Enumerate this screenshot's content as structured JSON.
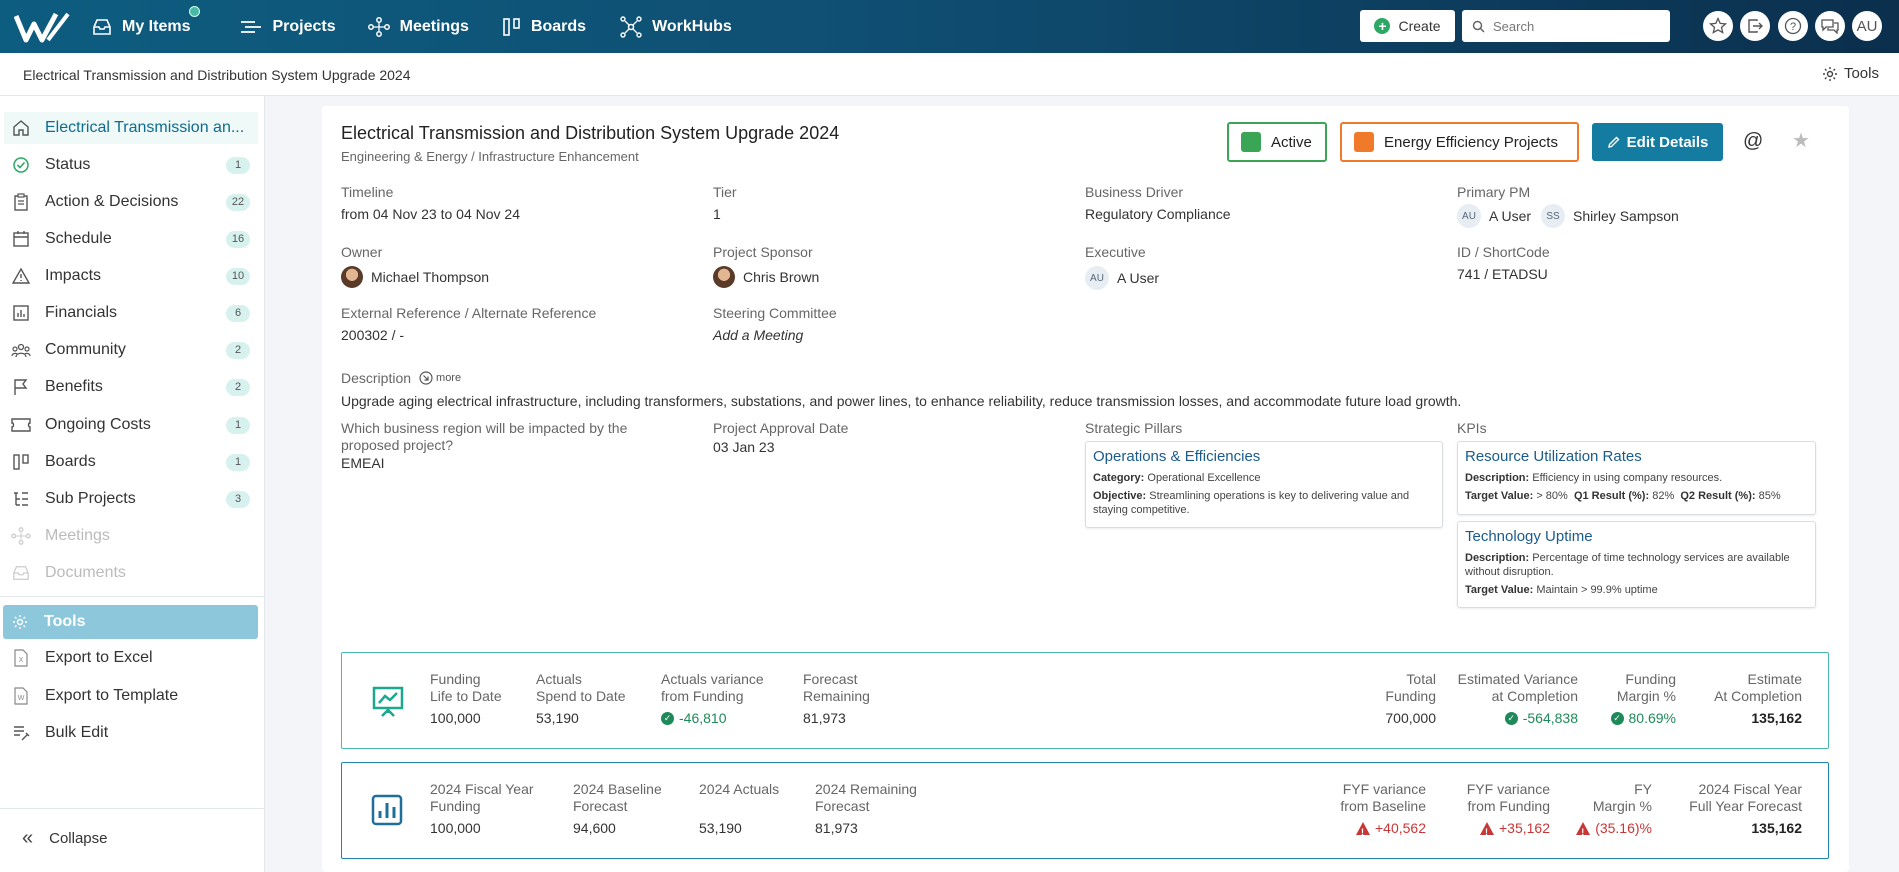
{
  "nav": {
    "items": [
      {
        "label": "My Items",
        "icon": "inbox-icon"
      },
      {
        "label": "Projects",
        "icon": "projects-icon"
      },
      {
        "label": "Meetings",
        "icon": "meetings-icon"
      },
      {
        "label": "Boards",
        "icon": "boards-icon"
      },
      {
        "label": "WorkHubs",
        "icon": "workhubs-icon"
      }
    ],
    "create_label": "Create",
    "search_placeholder": "Search",
    "avatar_initials": "AU"
  },
  "subheader": {
    "breadcrumb": "Electrical Transmission and Distribution System Upgrade 2024",
    "tools_label": "Tools"
  },
  "sidebar": {
    "items": [
      {
        "label": "Electrical Transmission an...",
        "count": ""
      },
      {
        "label": "Status",
        "count": "1"
      },
      {
        "label": "Action & Decisions",
        "count": "22"
      },
      {
        "label": "Schedule",
        "count": "16"
      },
      {
        "label": "Impacts",
        "count": "10"
      },
      {
        "label": "Financials",
        "count": "6"
      },
      {
        "label": "Community",
        "count": "2"
      },
      {
        "label": "Benefits",
        "count": "2"
      },
      {
        "label": "Ongoing Costs",
        "count": "1"
      },
      {
        "label": "Boards",
        "count": "1"
      },
      {
        "label": "Sub Projects",
        "count": "3"
      },
      {
        "label": "Meetings",
        "count": ""
      },
      {
        "label": "Documents",
        "count": ""
      }
    ],
    "tools": [
      {
        "label": "Tools"
      },
      {
        "label": "Export to Excel"
      },
      {
        "label": "Export to Template"
      },
      {
        "label": "Bulk Edit"
      }
    ],
    "collapse_label": "Collapse"
  },
  "project": {
    "title": "Electrical Transmission and Distribution System Upgrade 2024",
    "subtitle": "Engineering & Energy / Infrastructure Enhancement",
    "status": {
      "label": "Active",
      "color": "#3aa655"
    },
    "category": {
      "label": "Energy Efficiency Projects",
      "color": "#f07a2a"
    },
    "edit_label": "Edit Details",
    "fields": {
      "timeline": {
        "label": "Timeline",
        "value": "from 04 Nov 23 to 04 Nov 24"
      },
      "tier": {
        "label": "Tier",
        "value": "1"
      },
      "business_driver": {
        "label": "Business Driver",
        "value": "Regulatory Compliance"
      },
      "primary_pm": {
        "label": "Primary PM",
        "people": [
          {
            "initials": "AU",
            "name": "A User"
          },
          {
            "initials": "SS",
            "name": "Shirley Sampson"
          }
        ]
      },
      "owner": {
        "label": "Owner",
        "value": "Michael Thompson"
      },
      "sponsor": {
        "label": "Project Sponsor",
        "value": "Chris Brown"
      },
      "executive": {
        "label": "Executive",
        "initials": "AU",
        "value": "A User"
      },
      "id_shortcode": {
        "label": "ID / ShortCode",
        "value": "741 / ETADSU"
      },
      "ext_ref": {
        "label": "External Reference / Alternate Reference",
        "value": "200302 / -"
      },
      "steering": {
        "label": "Steering Committee",
        "value": "Add a Meeting"
      },
      "description": {
        "label": "Description",
        "more": "more",
        "value": "Upgrade aging electrical infrastructure, including transformers, substations, and power lines, to enhance reliability, reduce transmission losses, and accommodate future load growth."
      },
      "region": {
        "label": "Which business region will be impacted by the proposed project?",
        "value": "EMEAI"
      },
      "approval": {
        "label": "Project Approval Date",
        "value": "03 Jan 23"
      },
      "pillars_label": "Strategic Pillars",
      "kpis_label": "KPIs"
    },
    "pillars": [
      {
        "title": "Operations & Efficiencies",
        "category_label": "Category:",
        "category": "Operational Excellence",
        "objective_label": "Objective:",
        "objective": "Streamlining operations is key to delivering value and staying competitive."
      }
    ],
    "kpis": [
      {
        "title": "Resource Utilization Rates",
        "desc_label": "Description:",
        "desc": "Efficiency in using company resources.",
        "target_label": "Target Value:",
        "target": "> 80%",
        "q1_label": "Q1 Result (%):",
        "q1": "82%",
        "q2_label": "Q2 Result (%):",
        "q2": "85%"
      },
      {
        "title": "Technology Uptime",
        "desc_label": "Description:",
        "desc": "Percentage of time technology services are available without disruption.",
        "target_label": "Target Value:",
        "target": "Maintain > 99.9% uptime"
      }
    ]
  },
  "funding": {
    "left": [
      {
        "l1": "Funding",
        "l2": "Life to Date",
        "value": "100,000"
      },
      {
        "l1": "Actuals",
        "l2": "Spend to Date",
        "value": "53,190"
      },
      {
        "l1": "Actuals variance",
        "l2": "from Funding",
        "value": "-46,810"
      },
      {
        "l1": "Forecast",
        "l2": "Remaining",
        "value": "81,973"
      }
    ],
    "right": [
      {
        "l1": "Total",
        "l2": "Funding",
        "value": "700,000"
      },
      {
        "l1": "Estimated Variance",
        "l2": "at Completion",
        "value": "-564,838"
      },
      {
        "l1": "Funding",
        "l2": "Margin %",
        "value": "80.69%"
      },
      {
        "l1": "Estimate",
        "l2": "At Completion",
        "value": "135,162"
      }
    ]
  },
  "fiscal": {
    "left": [
      {
        "l1": "2024 Fiscal Year",
        "l2": "Funding",
        "value": "100,000"
      },
      {
        "l1": "2024 Baseline",
        "l2": "Forecast",
        "value": "94,600"
      },
      {
        "l1": "2024 Actuals",
        "l2": "",
        "value": "53,190"
      },
      {
        "l1": "2024 Remaining",
        "l2": "Forecast",
        "value": "81,973"
      }
    ],
    "right": [
      {
        "l1": "FYF variance",
        "l2": "from Baseline",
        "value": "+40,562"
      },
      {
        "l1": "FYF variance",
        "l2": "from Funding",
        "value": "+35,162"
      },
      {
        "l1": "FY",
        "l2": "Margin %",
        "value": "(35.16)%"
      },
      {
        "l1": "2024 Fiscal Year",
        "l2": "Full Year Forecast",
        "value": "135,162"
      }
    ]
  }
}
